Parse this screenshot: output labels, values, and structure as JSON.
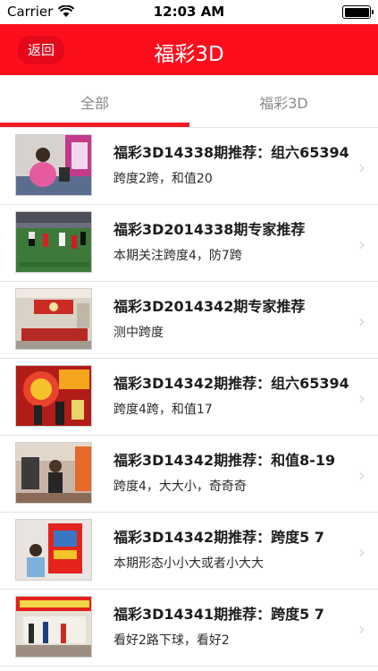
{
  "status_bar": {
    "carrier": "Carrier",
    "time": "12:03 AM"
  },
  "nav": {
    "back_label": "返回",
    "title": "福彩3D"
  },
  "tabs": [
    {
      "label": "全部",
      "selected": true
    },
    {
      "label": "福彩3D",
      "selected": false
    }
  ],
  "colors": {
    "nav_red": "#fd0e1c",
    "tab_indicator": "#ee1c25"
  },
  "articles": [
    {
      "title": "福彩3D14338期推荐：组六65394",
      "subtitle": "跨度2跨，和值20",
      "image": "woman-at-lottery-counter"
    },
    {
      "title": "福彩3D2014338期专家推荐",
      "subtitle": "本期关注跨度4，防7跨",
      "image": "soccer-match"
    },
    {
      "title": "福彩3D2014342期专家推荐",
      "subtitle": "测中跨度",
      "image": "lottery-shop-interior"
    },
    {
      "title": "福彩3D14342期推荐：组六65394",
      "subtitle": "跨度4跨，和值17",
      "image": "lottery-stage-event"
    },
    {
      "title": "福彩3D14342期推荐：和值8-19",
      "subtitle": "跨度4，大大小，奇奇奇",
      "image": "lottery-shop-people"
    },
    {
      "title": "福彩3D14342期推荐：跨度5 7",
      "subtitle": "本期形态小小大或者小大大",
      "image": "lottery-terminal-kiosk"
    },
    {
      "title": "福彩3D14341期推荐：跨度5 7",
      "subtitle": "看好2路下球，看好2",
      "image": "lottery-storefront"
    }
  ]
}
